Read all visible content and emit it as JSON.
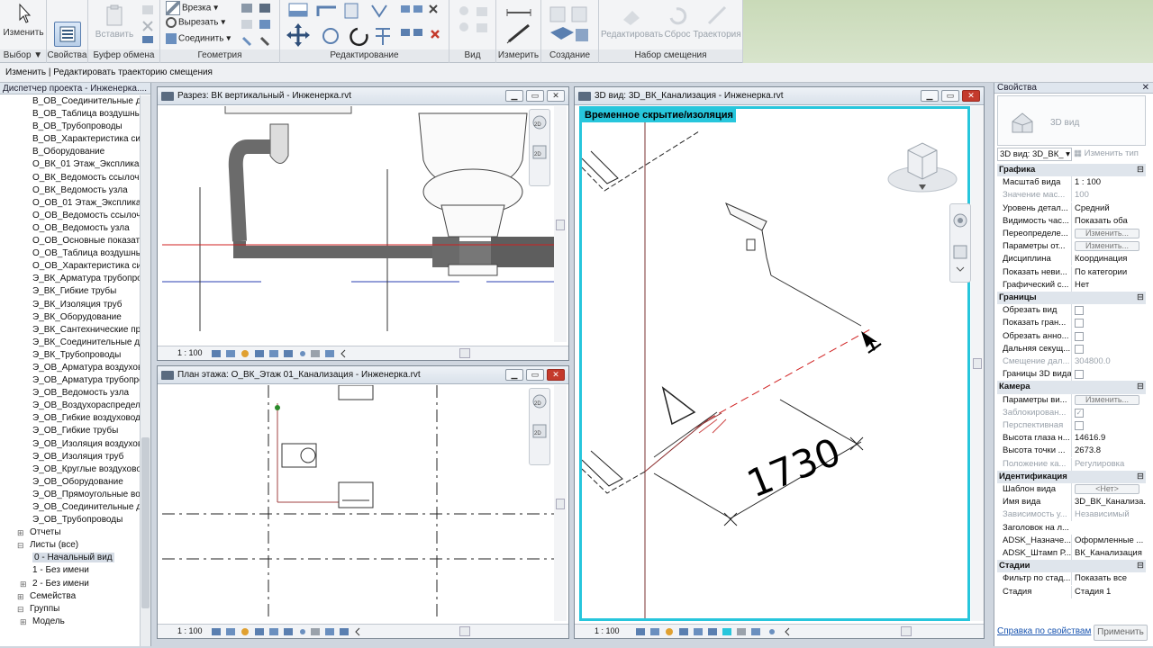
{
  "ribbon": {
    "modify_label": "Изменить",
    "select_label": "Выбор ▼",
    "properties_panel": "Свойства",
    "paste_label": "Вставить",
    "clipboard_panel": "Буфер обмена",
    "cut_in_label": "Врезка",
    "cut_label": "Вырезать",
    "join_label": "Соединить",
    "geometry_panel": "Геометрия",
    "edit_panel": "Редактирование",
    "view_panel": "Вид",
    "measure_panel": "Измерить",
    "create_panel": "Создание",
    "edit_offset_label": "Редактировать",
    "reset_label": "Сброс",
    "trajectory_label": "Траектория",
    "offset_set_panel": "Набор смещения"
  },
  "options_bar": {
    "text": "Изменить | Редактировать траекторию смещения"
  },
  "browser": {
    "title": "Диспетчер проекта - Инженерка....",
    "items": [
      {
        "label": "В_ОВ_Соединительные дет",
        "indent": 36
      },
      {
        "label": "В_ОВ_Таблица воздушных",
        "indent": 36
      },
      {
        "label": "В_ОВ_Трубопроводы",
        "indent": 36
      },
      {
        "label": "В_ОВ_Характеристика сист",
        "indent": 36
      },
      {
        "label": "В_Оборудование",
        "indent": 36
      },
      {
        "label": "О_ВК_01 Этаж_Экспликаци",
        "indent": 36
      },
      {
        "label": "О_ВК_Ведомость ссылочны",
        "indent": 36
      },
      {
        "label": "О_ВК_Ведомость узла",
        "indent": 36
      },
      {
        "label": "О_ОВ_01 Этаж_Экспликаци",
        "indent": 36
      },
      {
        "label": "О_ОВ_Ведомость ссылочны",
        "indent": 36
      },
      {
        "label": "О_ОВ_Ведомость узла",
        "indent": 36
      },
      {
        "label": "О_ОВ_Основные показател",
        "indent": 36
      },
      {
        "label": "О_ОВ_Таблица воздушных",
        "indent": 36
      },
      {
        "label": "О_ОВ_Характеристика сист",
        "indent": 36
      },
      {
        "label": "Э_ВК_Арматура трубопрово",
        "indent": 36
      },
      {
        "label": "Э_ВК_Гибкие трубы",
        "indent": 36
      },
      {
        "label": "Э_ВК_Изоляция труб",
        "indent": 36
      },
      {
        "label": "Э_ВК_Оборудование",
        "indent": 36
      },
      {
        "label": "Э_ВК_Сантехнические приб",
        "indent": 36
      },
      {
        "label": "Э_ВК_Соединительные дета",
        "indent": 36
      },
      {
        "label": "Э_ВК_Трубопроводы",
        "indent": 36
      },
      {
        "label": "Э_ОВ_Арматура воздухово,",
        "indent": 36
      },
      {
        "label": "Э_ОВ_Арматура трубопров",
        "indent": 36
      },
      {
        "label": "Э_ОВ_Ведомость узла",
        "indent": 36
      },
      {
        "label": "Э_ОВ_Воздухораспределит",
        "indent": 36
      },
      {
        "label": "Э_ОВ_Гибкие воздуховоды",
        "indent": 36
      },
      {
        "label": "Э_ОВ_Гибкие трубы",
        "indent": 36
      },
      {
        "label": "Э_ОВ_Изоляция воздухово,",
        "indent": 36
      },
      {
        "label": "Э_ОВ_Изоляция труб",
        "indent": 36
      },
      {
        "label": "Э_ОВ_Круглые воздуховоды",
        "indent": 36
      },
      {
        "label": "Э_ОВ_Оборудование",
        "indent": 36
      },
      {
        "label": "Э_ОВ_Прямоугольные возд",
        "indent": 36
      },
      {
        "label": "Э_ОВ_Соединительные дет",
        "indent": 36
      },
      {
        "label": "Э_ОВ_Трубопроводы",
        "indent": 36
      },
      {
        "label": "Отчеты",
        "indent": 33,
        "toggle": "+"
      },
      {
        "label": "Листы (все)",
        "indent": 33,
        "toggle": "−"
      },
      {
        "label": "0 - Начальный вид",
        "indent": 36,
        "selected": true
      },
      {
        "label": "1 - Без имени",
        "indent": 36
      },
      {
        "label": "2 - Без имени",
        "indent": 36,
        "toggle": "+"
      },
      {
        "label": "Семейства",
        "indent": 33,
        "toggle": "+"
      },
      {
        "label": "Группы",
        "indent": 33,
        "toggle": "−"
      },
      {
        "label": "Модель",
        "indent": 36,
        "toggle": "+"
      }
    ]
  },
  "view_section": {
    "title": "Разрез: ВК вертикальный - Инженерка.rvt",
    "scale": "1 : 100"
  },
  "view_plan": {
    "title": "План этажа: О_ВК_Этаж 01_Канализация - Инженерка.rvt",
    "scale": "1 : 100"
  },
  "view_3d": {
    "title": "3D вид: 3D_ВК_Канализация - Инженерка.rvt",
    "scale": "1 : 100",
    "banner": "Временное скрытие/изоляция",
    "dimension": "1730"
  },
  "properties": {
    "title": "Свойства",
    "type_name": "3D вид",
    "selector": "3D вид: 3D_ВК_",
    "edit_type": "Изменить тип",
    "rows": [
      {
        "type": "section",
        "k": "Графика"
      },
      {
        "k": "Масштаб вида",
        "v": "1 : 100"
      },
      {
        "k": "Значение мас...",
        "v": "100",
        "gray": true
      },
      {
        "k": "Уровень детал...",
        "v": "Средний"
      },
      {
        "k": "Видимость час...",
        "v": "Показать оба"
      },
      {
        "k": "Переопределе...",
        "v": "Изменить...",
        "button": true
      },
      {
        "k": "Параметры от...",
        "v": "Изменить...",
        "button": true
      },
      {
        "k": "Дисциплина",
        "v": "Координация"
      },
      {
        "k": "Показать неви...",
        "v": "По категории"
      },
      {
        "k": "Графический с...",
        "v": "Нет"
      },
      {
        "type": "section",
        "k": "Границы"
      },
      {
        "k": "Обрезать вид",
        "v": "",
        "check": true
      },
      {
        "k": "Показать гран...",
        "v": "",
        "check": true
      },
      {
        "k": "Обрезать анно...",
        "v": "",
        "check": true
      },
      {
        "k": "Дальняя секущ...",
        "v": "",
        "check": true
      },
      {
        "k": "Смещение дал...",
        "v": "304800.0",
        "gray": true
      },
      {
        "k": "Границы 3D вида",
        "v": "",
        "check": true
      },
      {
        "type": "section",
        "k": "Камера"
      },
      {
        "k": "Параметры ви...",
        "v": "Изменить...",
        "button": true
      },
      {
        "k": "Заблокирован...",
        "v": "✓",
        "check": true,
        "gray": true
      },
      {
        "k": "Перспективная",
        "v": "",
        "check": true,
        "gray": true
      },
      {
        "k": "Высота глаза н...",
        "v": "14616.9"
      },
      {
        "k": "Высота точки ...",
        "v": "2673.8"
      },
      {
        "k": "Положение ка...",
        "v": "Регулировка",
        "gray": true
      },
      {
        "type": "section",
        "k": "Идентификация"
      },
      {
        "k": "Шаблон вида",
        "v": "<Нет>",
        "button": true
      },
      {
        "k": "Имя вида",
        "v": "3D_ВК_Канализа..."
      },
      {
        "k": "Зависимость у...",
        "v": "Независимый",
        "gray": true
      },
      {
        "k": "Заголовок на л...",
        "v": ""
      },
      {
        "k": "ADSK_Назначе...",
        "v": "Оформленные ..."
      },
      {
        "k": "ADSK_Штамп Р...",
        "v": "ВК_Канализация"
      },
      {
        "type": "section",
        "k": "Стадии"
      },
      {
        "k": "Фильтр по стад...",
        "v": "Показать все"
      },
      {
        "k": "Стадия",
        "v": "Стадия 1"
      }
    ],
    "help_link": "Справка по свойствам",
    "apply": "Применить"
  }
}
